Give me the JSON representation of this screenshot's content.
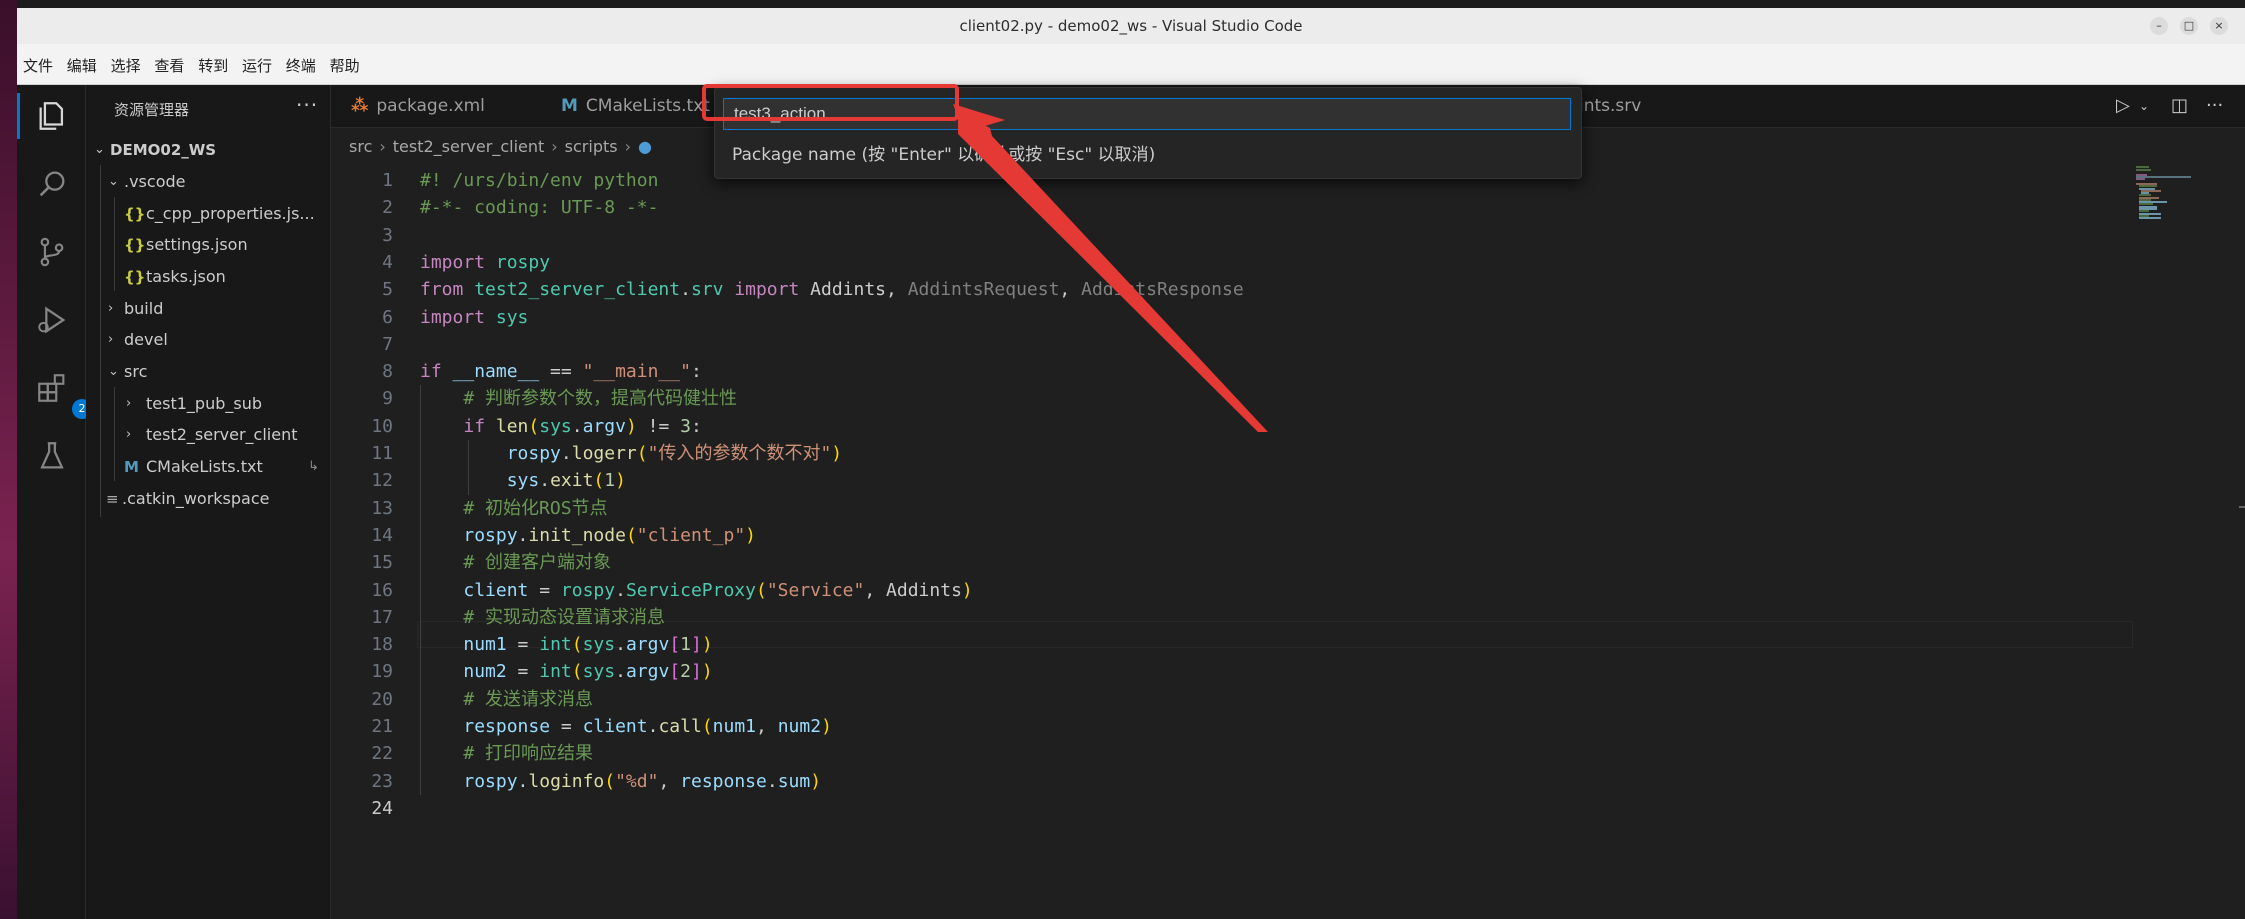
{
  "window": {
    "title": "client02.py - demo02_ws - Visual Studio Code",
    "controls": [
      "–",
      "□",
      "×"
    ]
  },
  "menu": [
    "文件",
    "编辑",
    "选择",
    "查看",
    "转到",
    "运行",
    "终端",
    "帮助"
  ],
  "activity_bar": {
    "items": [
      {
        "name": "explorer-icon",
        "active": true
      },
      {
        "name": "search-icon"
      },
      {
        "name": "source-control-icon"
      },
      {
        "name": "run-debug-icon"
      },
      {
        "name": "extensions-icon",
        "badge": "2"
      },
      {
        "name": "testing-icon"
      }
    ]
  },
  "sidebar": {
    "title": "资源管理器",
    "more": "···",
    "root": "DEMO02_WS",
    "items": [
      {
        "label": ".vscode",
        "kind": "folder-open",
        "icon_char": ""
      },
      {
        "label": "c_cpp_properties.js...",
        "kind": "json",
        "icon_char": "{}"
      },
      {
        "label": "settings.json",
        "kind": "json",
        "icon_char": "{}"
      },
      {
        "label": "tasks.json",
        "kind": "json",
        "icon_char": "{}"
      },
      {
        "label": "build",
        "kind": "folder"
      },
      {
        "label": "devel",
        "kind": "folder"
      },
      {
        "label": "src",
        "kind": "folder-open"
      },
      {
        "label": "test1_pub_sub",
        "kind": "folder"
      },
      {
        "label": "test2_server_client",
        "kind": "folder"
      },
      {
        "label": "CMakeLists.txt",
        "kind": "cmake",
        "icon_char": "M",
        "trail": "↳"
      },
      {
        "label": ".catkin_workspace",
        "kind": "text",
        "icon_char": "≡"
      }
    ]
  },
  "tabs": [
    {
      "label": "package.xml",
      "icon_char": "⁂"
    },
    {
      "label": "CMakeLists.txt",
      "icon_char": "M"
    },
    {
      "label": "ints.srv",
      "icon_char": ""
    }
  ],
  "breadcrumb": [
    "src",
    "test2_server_client",
    "scripts"
  ],
  "breadcrumb_sep": "›",
  "quick_input": {
    "value": "test3_action",
    "message": "Package name (按 \"Enter\" 以确认或按 \"Esc\" 以取消)"
  },
  "code": {
    "line_numbers": [
      "1",
      "2",
      "3",
      "4",
      "5",
      "6",
      "7",
      "8",
      "9",
      "10",
      "11",
      "12",
      "13",
      "14",
      "15",
      "16",
      "17",
      "18",
      "19",
      "20",
      "21",
      "22",
      "23",
      "24"
    ],
    "lines": [
      [
        [
          "cm",
          "#! /urs/bin/env python"
        ]
      ],
      [
        [
          "cm",
          "#-*- coding: UTF-8 -*-"
        ]
      ],
      [],
      [
        [
          "kw",
          "import "
        ],
        [
          "mod",
          "rospy"
        ]
      ],
      [
        [
          "kw",
          "from "
        ],
        [
          "mod",
          "test2_server_client"
        ],
        [
          "def",
          "."
        ],
        [
          "mod",
          "srv"
        ],
        [
          "kw",
          " import "
        ],
        [
          "def",
          "Addints, "
        ],
        [
          "dim",
          "AddintsRequest"
        ],
        [
          "def",
          ", "
        ],
        [
          "dim",
          "AddintsResponse"
        ]
      ],
      [
        [
          "kw",
          "import "
        ],
        [
          "mod",
          "sys"
        ]
      ],
      [],
      [
        [
          "kw",
          "if "
        ],
        [
          "var",
          "__name__"
        ],
        [
          "def",
          " == "
        ],
        [
          "str",
          "\"__main__\""
        ],
        [
          "def",
          ":"
        ]
      ],
      [
        [
          "def",
          "    "
        ],
        [
          "cm",
          "# 判断参数个数，提高代码健壮性"
        ]
      ],
      [
        [
          "def",
          "    "
        ],
        [
          "kw",
          "if "
        ],
        [
          "fn",
          "len"
        ],
        [
          "br1",
          "("
        ],
        [
          "mod",
          "sys"
        ],
        [
          "def",
          "."
        ],
        [
          "var",
          "argv"
        ],
        [
          "br1",
          ")"
        ],
        [
          "def",
          " != "
        ],
        [
          "num",
          "3"
        ],
        [
          "def",
          ":"
        ]
      ],
      [
        [
          "def",
          "        "
        ],
        [
          "var",
          "rospy"
        ],
        [
          "def",
          "."
        ],
        [
          "fn",
          "logerr"
        ],
        [
          "br1",
          "("
        ],
        [
          "str",
          "\"传入的参数个数不对\""
        ],
        [
          "br1",
          ")"
        ]
      ],
      [
        [
          "def",
          "        "
        ],
        [
          "var",
          "sys"
        ],
        [
          "def",
          "."
        ],
        [
          "fn",
          "exit"
        ],
        [
          "br1",
          "("
        ],
        [
          "num",
          "1"
        ],
        [
          "br1",
          ")"
        ]
      ],
      [
        [
          "def",
          "    "
        ],
        [
          "cm",
          "# 初始化ROS节点"
        ]
      ],
      [
        [
          "def",
          "    "
        ],
        [
          "var",
          "rospy"
        ],
        [
          "def",
          "."
        ],
        [
          "fn",
          "init_node"
        ],
        [
          "br1",
          "("
        ],
        [
          "str",
          "\"client_p\""
        ],
        [
          "br1",
          ")"
        ]
      ],
      [
        [
          "def",
          "    "
        ],
        [
          "cm",
          "# 创建客户端对象"
        ]
      ],
      [
        [
          "def",
          "    "
        ],
        [
          "var",
          "client"
        ],
        [
          "def",
          " = "
        ],
        [
          "mod",
          "rospy"
        ],
        [
          "def",
          "."
        ],
        [
          "mod",
          "ServiceProxy"
        ],
        [
          "br1",
          "("
        ],
        [
          "str",
          "\"Service\""
        ],
        [
          "def",
          ", Addints"
        ],
        [
          "br1",
          ")"
        ]
      ],
      [
        [
          "def",
          "    "
        ],
        [
          "cm",
          "# 实现动态设置请求消息"
        ]
      ],
      [
        [
          "def",
          "    "
        ],
        [
          "var",
          "num1"
        ],
        [
          "def",
          " = "
        ],
        [
          "mod",
          "int"
        ],
        [
          "br1",
          "("
        ],
        [
          "mod",
          "sys"
        ],
        [
          "def",
          "."
        ],
        [
          "var",
          "argv"
        ],
        [
          "br2",
          "["
        ],
        [
          "num",
          "1"
        ],
        [
          "br2",
          "]"
        ],
        [
          "br1",
          ")"
        ]
      ],
      [
        [
          "def",
          "    "
        ],
        [
          "var",
          "num2"
        ],
        [
          "def",
          " = "
        ],
        [
          "mod",
          "int"
        ],
        [
          "br1",
          "("
        ],
        [
          "mod",
          "sys"
        ],
        [
          "def",
          "."
        ],
        [
          "var",
          "argv"
        ],
        [
          "br2",
          "["
        ],
        [
          "num",
          "2"
        ],
        [
          "br2",
          "]"
        ],
        [
          "br1",
          ")"
        ]
      ],
      [
        [
          "def",
          "    "
        ],
        [
          "cm",
          "# 发送请求消息"
        ]
      ],
      [
        [
          "def",
          "    "
        ],
        [
          "var",
          "response"
        ],
        [
          "def",
          " = "
        ],
        [
          "var",
          "client"
        ],
        [
          "def",
          "."
        ],
        [
          "fn",
          "call"
        ],
        [
          "br1",
          "("
        ],
        [
          "var",
          "num1"
        ],
        [
          "def",
          ", "
        ],
        [
          "var",
          "num2"
        ],
        [
          "br1",
          ")"
        ]
      ],
      [
        [
          "def",
          "    "
        ],
        [
          "cm",
          "# 打印响应结果"
        ]
      ],
      [
        [
          "def",
          "    "
        ],
        [
          "var",
          "rospy"
        ],
        [
          "def",
          "."
        ],
        [
          "fn",
          "loginfo"
        ],
        [
          "br1",
          "("
        ],
        [
          "str",
          "\"%d\""
        ],
        [
          "def",
          ", "
        ],
        [
          "var",
          "response"
        ],
        [
          "def",
          "."
        ],
        [
          "var",
          "sum"
        ],
        [
          "br1",
          ")"
        ]
      ],
      []
    ]
  },
  "colors": {
    "accent": "#0078d4",
    "highlight": "#e53935",
    "editor_bg": "#1f1f1f",
    "sidebar_bg": "#181818"
  }
}
